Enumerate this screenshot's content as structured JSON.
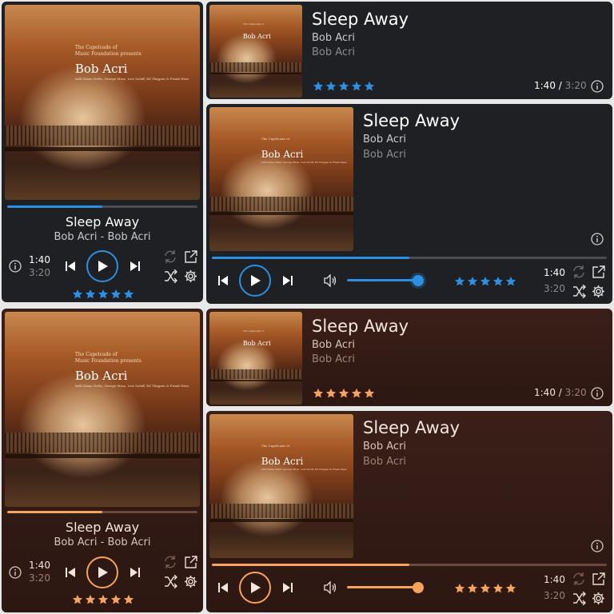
{
  "track": {
    "title": "Sleep Away",
    "artist": "Bob Acri",
    "album": "Bob Acri",
    "artist_album": "Bob Acri - Bob Acri",
    "elapsed": "1:40",
    "duration": "3:20",
    "separator": "/",
    "progress_fraction": 0.5,
    "rating": 5,
    "rating_max": 5
  },
  "cover_text": {
    "line1": "The Capelcade of",
    "line2": "Music Foundation presents",
    "name": "Bob Acri",
    "credits": "with Diane Delin, George Mraz, Lew Soloff, Ed Thigpen & Frank Wess"
  },
  "volume_fraction": 0.78,
  "themes": {
    "dark": {
      "accent": "#2b8fe3"
    },
    "warm": {
      "accent": "#f7a35c"
    }
  },
  "icons": [
    "info-icon",
    "previous-icon",
    "play-icon",
    "next-icon",
    "repeat-icon",
    "external-link-icon",
    "shuffle-icon",
    "settings-icon",
    "volume-icon",
    "star-icon"
  ]
}
